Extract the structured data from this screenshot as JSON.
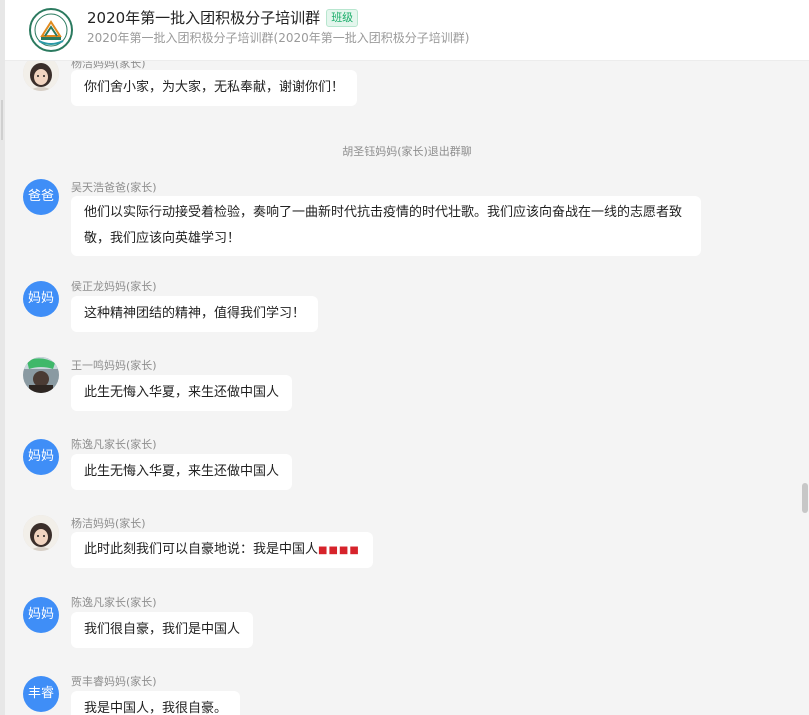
{
  "header": {
    "title": "2020年第一批入团积极分子培训群",
    "badge": "班级",
    "subtitle": "2020年第一批入团积极分子培训群(2020年第一批入团积极分子培训群)"
  },
  "messages": [
    {
      "sender": "杨洁妈妈(家长)",
      "avatar_type": "photo",
      "avatar_label": "",
      "text": "你们舍小家，为大家，无私奉献，谢谢你们！"
    },
    {
      "system": "胡圣钰妈妈(家长)退出群聊"
    },
    {
      "sender": "吴天浩爸爸(家长)",
      "avatar_type": "text",
      "avatar_label": "爸爸",
      "text": "他们以实际行动接受着检验，奏响了一曲新时代抗击疫情的时代壮歌。我们应该向奋战在一线的志愿者致敬，我们应该向英雄学习！"
    },
    {
      "sender": "侯正龙妈妈(家长)",
      "avatar_type": "text",
      "avatar_label": "妈妈",
      "text": "这种精神团结的精神，值得我们学习！"
    },
    {
      "sender": "王一鸣妈妈(家长)",
      "avatar_type": "photo",
      "avatar_label": "",
      "text": "此生无悔入华夏，来生还做中国人"
    },
    {
      "sender": "陈逸凡家长(家长)",
      "avatar_type": "text",
      "avatar_label": "妈妈",
      "text": "此生无悔入华夏，来生还做中国人"
    },
    {
      "sender": "杨洁妈妈(家长)",
      "avatar_type": "photo",
      "avatar_label": "",
      "text": "此时此刻我们可以自豪地说：我是中国人",
      "emoji": "■■■■"
    },
    {
      "sender": "陈逸凡家长(家长)",
      "avatar_type": "text",
      "avatar_label": "妈妈",
      "text": "我们很自豪，我们是中国人"
    },
    {
      "sender": "贾丰睿妈妈(家长)",
      "avatar_type": "text",
      "avatar_label": "丰睿",
      "text": "我是中国人，我很自豪。"
    }
  ],
  "icons": {
    "logo": "school-emblem-icon",
    "photo_avatar": "user-photo-avatar"
  },
  "colors": {
    "avatar_blue": "#3f8ef7",
    "badge_green": "#1aad6a",
    "chat_bg": "#f4f4f4"
  }
}
